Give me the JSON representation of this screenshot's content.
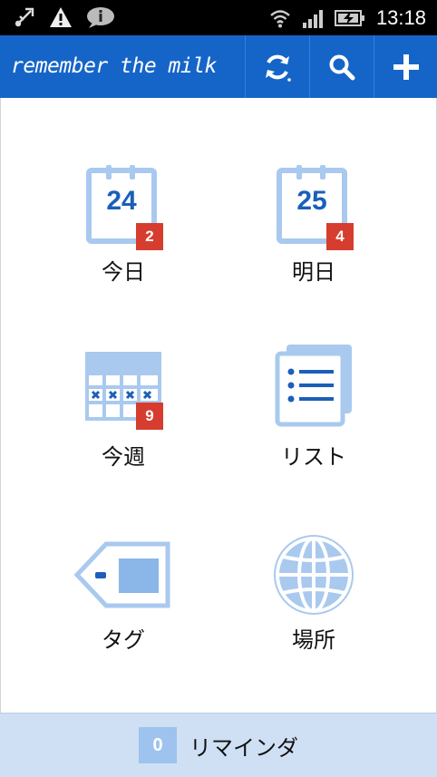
{
  "status_bar": {
    "time": "13:18",
    "icons": [
      "usb-debug-icon",
      "warning-icon",
      "chat-bubble-icon",
      "wifi-icon",
      "signal-icon",
      "battery-charging-icon"
    ]
  },
  "app_bar": {
    "title": "remember the milk",
    "actions": [
      "sync-icon",
      "search-icon",
      "add-icon"
    ]
  },
  "tiles": [
    {
      "id": "today",
      "label": "今日",
      "calendar_day": "24",
      "badge": "2"
    },
    {
      "id": "tomorrow",
      "label": "明日",
      "calendar_day": "25",
      "badge": "4"
    },
    {
      "id": "this_week",
      "label": "今週",
      "badge": "9"
    },
    {
      "id": "lists",
      "label": "リスト"
    },
    {
      "id": "tags",
      "label": "タグ"
    },
    {
      "id": "locations",
      "label": "場所"
    }
  ],
  "reminder": {
    "count": "0",
    "label": "リマインダ"
  },
  "colors": {
    "app_bar": "#1565c8",
    "badge": "#d63d2e",
    "icon_light": "#a9c9ef",
    "icon_dark": "#1b5fb8",
    "bottom_bar": "#cfe0f4"
  }
}
